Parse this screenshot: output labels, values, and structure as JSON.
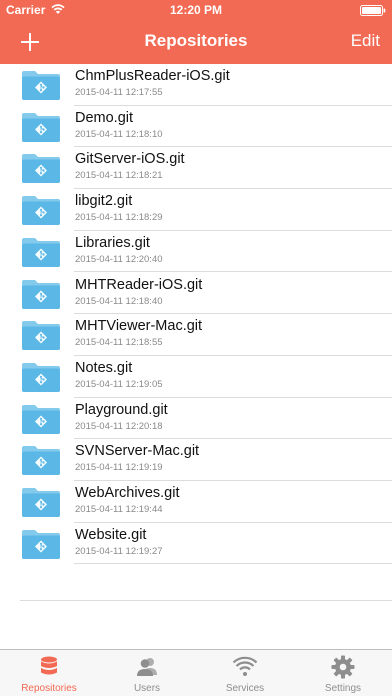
{
  "status_bar": {
    "carrier": "Carrier",
    "time": "12:20 PM"
  },
  "nav": {
    "add_label": "+",
    "title": "Repositories",
    "edit_label": "Edit"
  },
  "colors": {
    "accent": "#F26A53",
    "folder": "#5BB8E6",
    "inactive_tab": "#8e8e8e"
  },
  "repositories": [
    {
      "name": "ChmPlusReader-iOS.git",
      "date": "2015-04-11 12:17:55"
    },
    {
      "name": "Demo.git",
      "date": "2015-04-11 12:18:10"
    },
    {
      "name": "GitServer-iOS.git",
      "date": "2015-04-11 12:18:21"
    },
    {
      "name": "libgit2.git",
      "date": "2015-04-11 12:18:29"
    },
    {
      "name": "Libraries.git",
      "date": "2015-04-11 12:20:40"
    },
    {
      "name": "MHTReader-iOS.git",
      "date": "2015-04-11 12:18:40"
    },
    {
      "name": "MHTViewer-Mac.git",
      "date": "2015-04-11 12:18:55"
    },
    {
      "name": "Notes.git",
      "date": "2015-04-11 12:19:05"
    },
    {
      "name": "Playground.git",
      "date": "2015-04-11 12:20:18"
    },
    {
      "name": "SVNServer-Mac.git",
      "date": "2015-04-11 12:19:19"
    },
    {
      "name": "WebArchives.git",
      "date": "2015-04-11 12:19:44"
    },
    {
      "name": "Website.git",
      "date": "2015-04-11 12:19:27"
    }
  ],
  "tabs": [
    {
      "label": "Repositories",
      "icon": "database-icon",
      "active": true
    },
    {
      "label": "Users",
      "icon": "users-icon",
      "active": false
    },
    {
      "label": "Services",
      "icon": "wifi-icon",
      "active": false
    },
    {
      "label": "Settings",
      "icon": "gear-icon",
      "active": false
    }
  ]
}
